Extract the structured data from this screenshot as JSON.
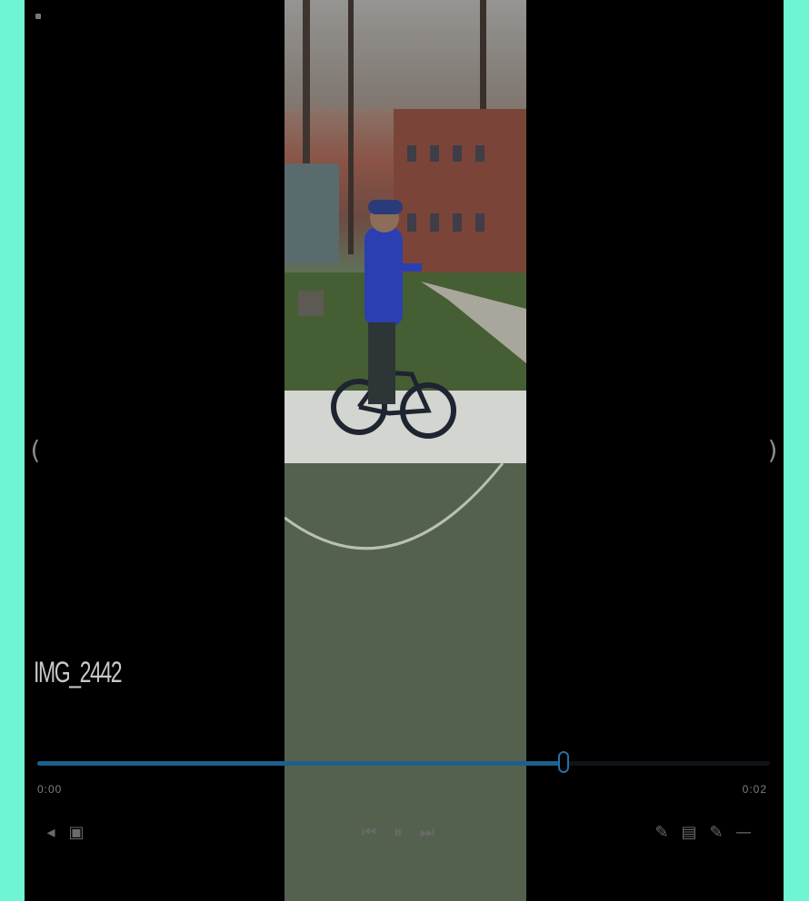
{
  "player": {
    "title": "IMG_2442",
    "elapsed": "0:00",
    "duration": "0:02",
    "progress_percent": 72,
    "nav": {
      "prev": "(",
      "next": ")"
    },
    "controls_left": [
      {
        "icon": "volume-icon",
        "glyph": "◂"
      },
      {
        "icon": "info-icon",
        "glyph": "▣"
      }
    ],
    "controls_center": [
      {
        "icon": "previous-icon",
        "glyph": "⏮"
      },
      {
        "icon": "pause-icon",
        "glyph": "⏸"
      },
      {
        "icon": "next-icon",
        "glyph": "⏭"
      }
    ],
    "controls_right": [
      {
        "icon": "edit-icon",
        "glyph": "✎"
      },
      {
        "icon": "cast-icon",
        "glyph": "▤"
      },
      {
        "icon": "draw-icon",
        "glyph": "✎"
      },
      {
        "icon": "more-icon",
        "glyph": "—"
      }
    ]
  },
  "colors": {
    "frame": "#6ff5d2",
    "background": "#000000",
    "accent": "#1e5f8c"
  }
}
